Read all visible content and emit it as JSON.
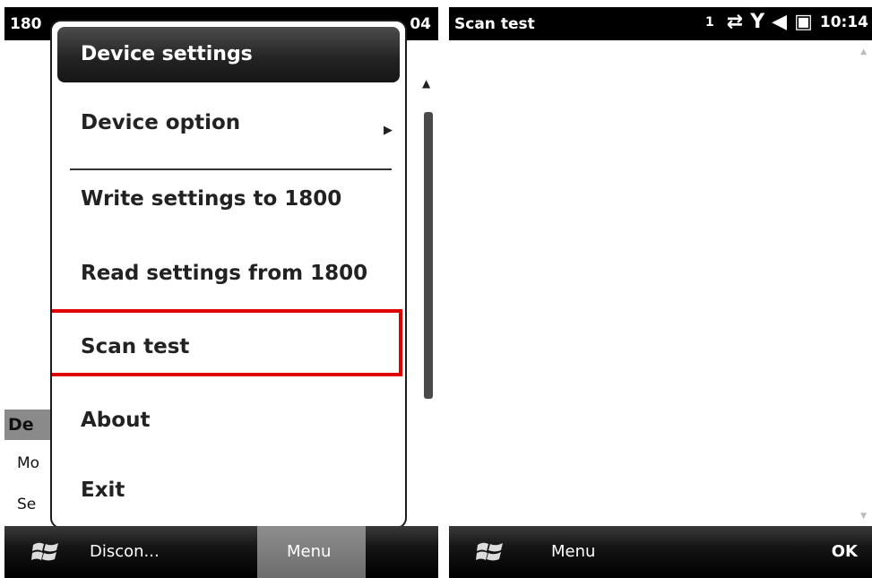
{
  "left_screen": {
    "status_title": "180",
    "status_time": "04",
    "background": {
      "header": "De",
      "row1": "Mo",
      "row2": "Se"
    },
    "popup": {
      "header": "Device settings",
      "items": [
        {
          "label": "Device option"
        },
        {
          "label": "Write settings to 1800"
        },
        {
          "label": "Read settings from 1800"
        },
        {
          "label": "Scan test"
        },
        {
          "label": "About"
        },
        {
          "label": "Exit"
        }
      ]
    },
    "softkeys": {
      "left": "Discon...",
      "right": "Menu"
    }
  },
  "right_screen": {
    "status_title": "Scan test",
    "status_num": "1",
    "status_time": "10:14",
    "softkeys": {
      "left": "Menu",
      "right": "OK"
    }
  },
  "colors": {
    "highlight_border": "#e00000",
    "status_bar": "#000000"
  }
}
